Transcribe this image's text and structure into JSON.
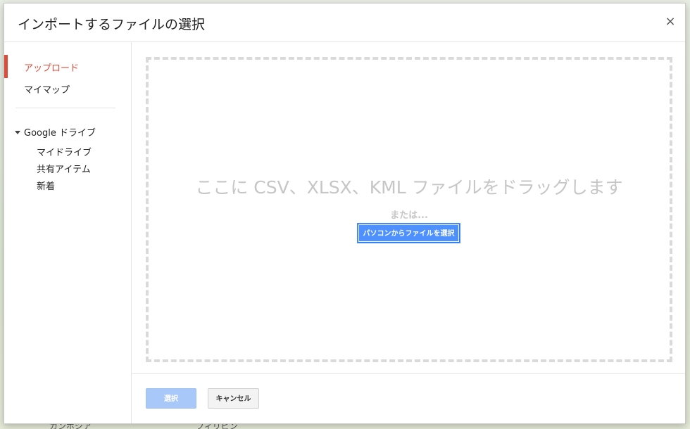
{
  "dialog": {
    "title": "インポートするファイルの選択",
    "close_label": "×"
  },
  "sidebar": {
    "items": [
      {
        "label": "アップロード",
        "active": true
      },
      {
        "label": "マイマップ",
        "active": false
      }
    ],
    "drive": {
      "label": "Google ドライブ",
      "expanded": true,
      "items": [
        {
          "label": "マイドライブ"
        },
        {
          "label": "共有アイテム"
        },
        {
          "label": "新着"
        }
      ]
    }
  },
  "dropzone": {
    "drag_text": "ここに CSV、XLSX、KML ファイルをドラッグします",
    "or_text": "または...",
    "select_button_label": "パソコンからファイルを選択"
  },
  "footer": {
    "select_label": "選択",
    "cancel_label": "キャンセル"
  },
  "background": {
    "labels": [
      "カンボジア",
      "フィリピン"
    ]
  },
  "colors": {
    "accent": "#dd4b39",
    "primary_button": "#4d90fe",
    "disabled_button": "#a9c8fa"
  }
}
